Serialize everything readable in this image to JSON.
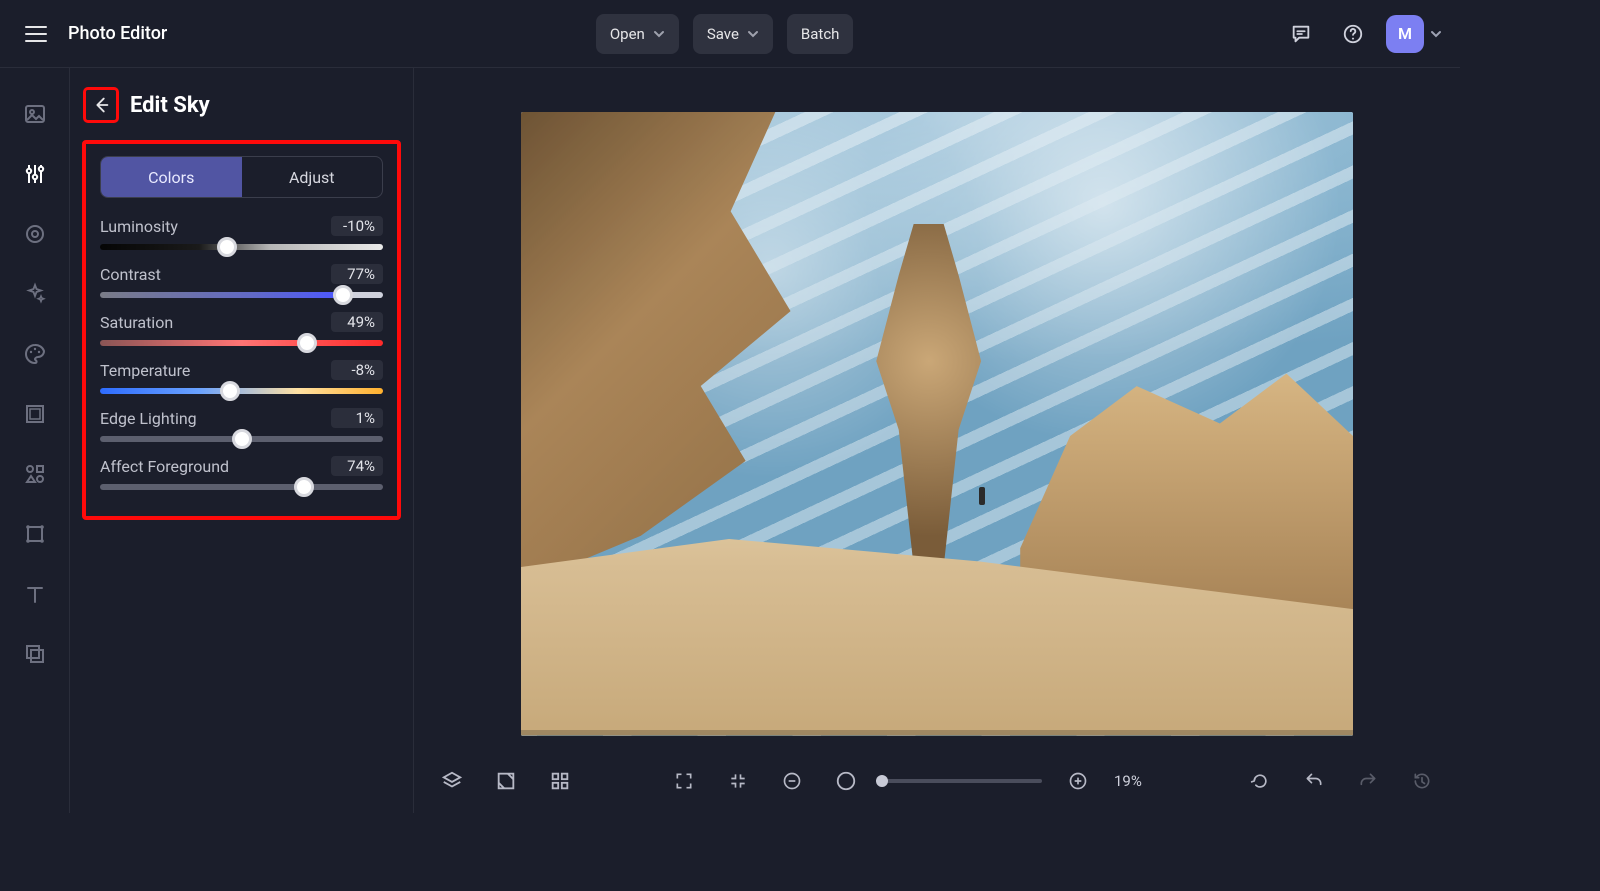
{
  "app": {
    "title": "Photo Editor"
  },
  "topbar": {
    "open_label": "Open",
    "save_label": "Save",
    "batch_label": "Batch",
    "avatar_initial": "M"
  },
  "panel": {
    "title": "Edit Sky",
    "tabs": {
      "colors": "Colors",
      "adjust": "Adjust"
    }
  },
  "sliders": {
    "luminosity": {
      "label": "Luminosity",
      "value": "-10%",
      "pos": 45
    },
    "contrast": {
      "label": "Contrast",
      "value": "77%",
      "pos": 86
    },
    "saturation": {
      "label": "Saturation",
      "value": "49%",
      "pos": 73
    },
    "temperature": {
      "label": "Temperature",
      "value": "-8%",
      "pos": 46
    },
    "edge": {
      "label": "Edge Lighting",
      "value": "1%",
      "pos": 50
    },
    "affect": {
      "label": "Affect Foreground",
      "value": "74%",
      "pos": 72
    }
  },
  "bottombar": {
    "zoom_label": "19%"
  }
}
